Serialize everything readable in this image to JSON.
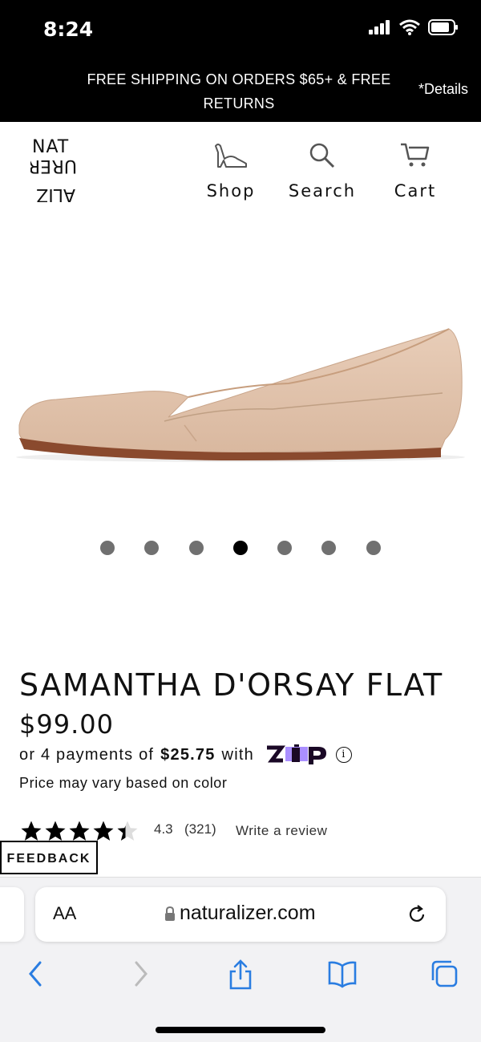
{
  "status_bar": {
    "time": "8:24"
  },
  "promo": {
    "text": "FREE SHIPPING ON ORDERS $65+ & FREE RETURNS",
    "details": "*Details"
  },
  "header": {
    "logo_lines": [
      "NAT",
      "UR",
      "ALIZ",
      "ER"
    ],
    "nav": [
      {
        "label": "Shop",
        "icon": "shoe-icon"
      },
      {
        "label": "Search",
        "icon": "search-icon"
      },
      {
        "label": "Cart",
        "icon": "cart-icon"
      }
    ]
  },
  "carousel": {
    "total": 7,
    "active_index": 3
  },
  "product": {
    "title": "SAMANTHA D'ORSAY FLAT",
    "price": "$99.00",
    "installments_prefix": "or 4 payments of",
    "installment_amount": "$25.75",
    "installments_suffix": "with",
    "price_note": "Price may vary based on color",
    "rating": "4.3",
    "review_count": "(321)",
    "write_review": "Write a review",
    "stars": 4.3
  },
  "feedback": {
    "label": "FEEDBACK"
  },
  "browser": {
    "aa_label": "AA",
    "url": "naturalizer.com"
  },
  "colors": {
    "banner": "#000000",
    "zip_purple": "#AA8FFF",
    "shoe": "#E3C6AE"
  }
}
